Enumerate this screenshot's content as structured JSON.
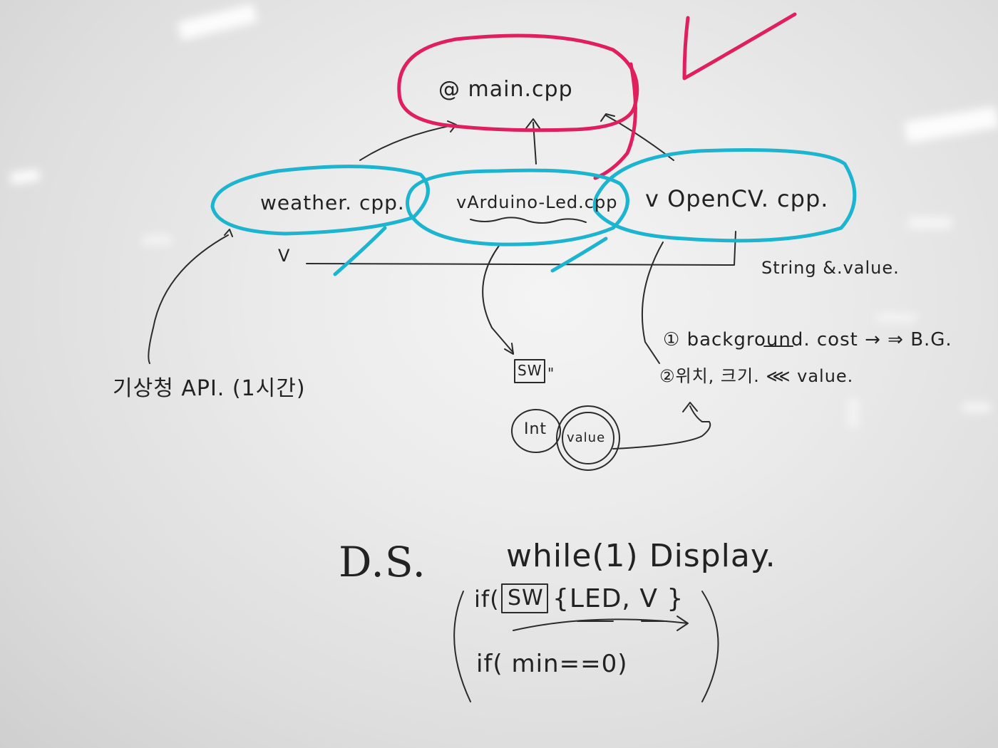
{
  "whiteboard": {
    "colors": {
      "ink": "#222222",
      "red_marker": "#e0205e",
      "cyan_marker": "#1cb4cf",
      "board": "#ececec"
    },
    "files": {
      "main": "@ main.cpp",
      "weather": "weather. cpp.",
      "arduino": "vArduino-Led.cpp",
      "opencv": "v OpenCV. cpp."
    },
    "labels": {
      "v_mark_left": "V",
      "string_value": "String &.value.",
      "api": "기상청 API. (1시간)",
      "sw_box": "SW",
      "sw_box_marks": "\"",
      "int": "Int",
      "value": "value",
      "bg_line1": "① background. cost → ⇒ B.G.",
      "bg_line2": "②위치, 크기. ⋘ value."
    },
    "bottom": {
      "ds": "D.S.",
      "while": "while(1) Display.",
      "if_prefix": "if(",
      "if_sw": "SW",
      "if_body": "{LED, V }",
      "if_min": "if( min==0)"
    }
  }
}
